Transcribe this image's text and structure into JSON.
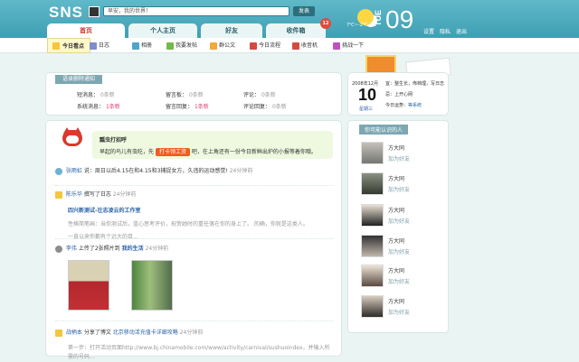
{
  "header": {
    "logo": "SNS",
    "status_value": "早安，我的世界！",
    "post_button": "发表",
    "temperature": "7℃~-2℃",
    "weekday": "TUE",
    "date_number": "09",
    "top_links": [
      "设置",
      "隐私",
      "退出"
    ],
    "tabs": [
      {
        "label": "首页",
        "active": true
      },
      {
        "label": "个人主页",
        "active": false
      },
      {
        "label": "好友",
        "active": false
      },
      {
        "label": "收件箱",
        "active": false,
        "badge": "12"
      }
    ]
  },
  "subnav": {
    "items": [
      {
        "label": "今日看点",
        "active": true,
        "color": "#f4c63b"
      },
      {
        "label": "日志",
        "active": false,
        "color": "#7d8ec9"
      },
      {
        "label": "相册",
        "active": false,
        "color": "#4ea5c8"
      },
      {
        "label": "我要发帖",
        "active": false,
        "color": "#75b84c"
      },
      {
        "label": "群公文",
        "active": false,
        "color": "#f0a93b"
      },
      {
        "label": "今日流程",
        "active": false,
        "color": "#d24b42"
      },
      {
        "label": "收音机",
        "active": false,
        "color": "#d24b42"
      },
      {
        "label": "挑战一下",
        "active": false,
        "color": "#be52c3"
      }
    ]
  },
  "updates": {
    "title": "语录删除通知",
    "stats": [
      {
        "key": "短消息：",
        "value": "0条新"
      },
      {
        "key": "留言板：",
        "value": "0条新"
      },
      {
        "key": "评论：",
        "value": "0条新"
      },
      {
        "key": "系统消息：",
        "value": "1条新",
        "highlight": true
      },
      {
        "key": "留言回复：",
        "value": "1条新",
        "highlight": true
      },
      {
        "key": "评论回复：",
        "value": "0条新"
      }
    ]
  },
  "calendar": {
    "month": "2008年12月",
    "day": "10",
    "weekday": "星期三",
    "yi": "宜：整生长，佈档理，写日志",
    "ji": "忌：上开心网",
    "fortune_label": "今日运势：",
    "fortune_value": "等系统"
  },
  "greeting": {
    "title": "瓢虫打招呼",
    "text_before": "早起的鸟儿有虫吃，先",
    "button": "打卡领工资",
    "text_after": "吧，在上角还有一份今日新鲜出炉的小报等着你哦。"
  },
  "feed": {
    "items": [
      {
        "user": "张雨虹",
        "action": "说：周日以后4.15在和4.15和3捕捉女方，久违的运动感觉!",
        "time": "24分钟前"
      },
      {
        "user": "陈乐华",
        "action": "撰写了日志",
        "time": "24分钟前",
        "title": "四兴新测试-壮志凌云的工作室",
        "lines": [
          "性格简笔画：当你测试后，蓝心思考评价，祝贺她时的重任落在你的身上了。    的确，你就是这类人。",
          "一直以来你都有个远大的目..."
        ]
      },
      {
        "user": "李伟",
        "action": "上传了2张照片到",
        "album": "我的生活",
        "time": "24分钟前"
      },
      {
        "user": "战柄本",
        "action": "分享了博文",
        "link": "北京移动活充值卡详细攻略",
        "time": "24分钟前",
        "line": "第一步：打开活动页面http://www.bj.chinamobile.com/www/activity/carnival/sushuoindex，并输入所需的号码..."
      }
    ]
  },
  "sidebar": {
    "title": "你可能认识的人",
    "people": [
      {
        "name": "方大同",
        "add": "加为好友"
      },
      {
        "name": "方大同",
        "add": "加为好友"
      },
      {
        "name": "方大同",
        "add": "加为好友"
      },
      {
        "name": "方大同",
        "add": "加为好友"
      },
      {
        "name": "方大同",
        "add": "加为好友"
      },
      {
        "name": "方大同",
        "add": "加为好友"
      }
    ]
  }
}
